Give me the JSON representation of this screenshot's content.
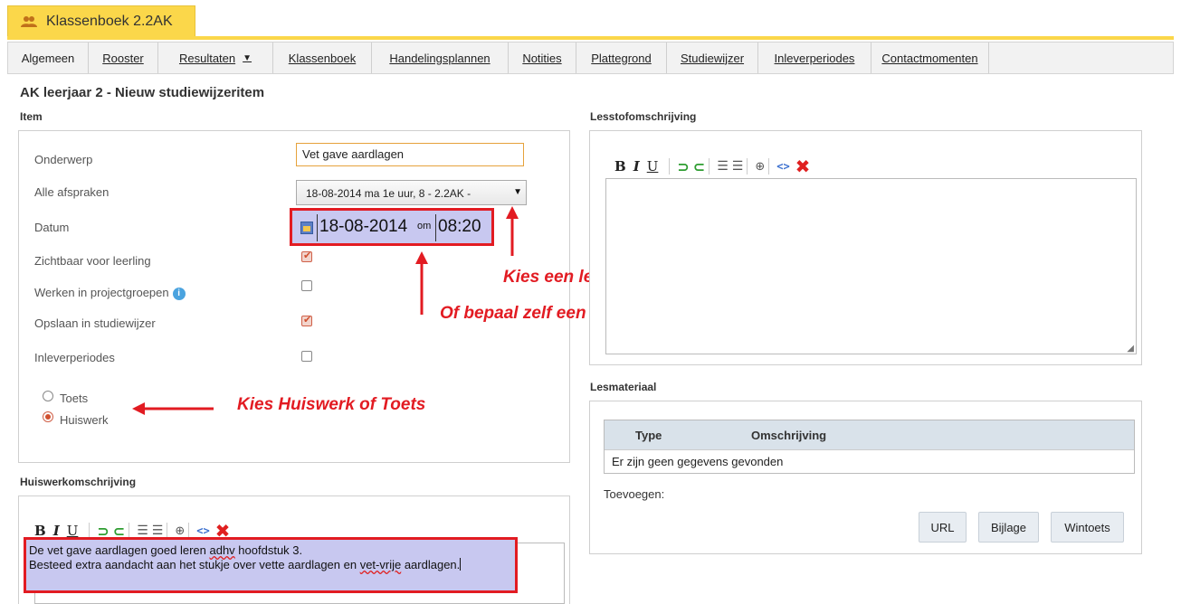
{
  "window": {
    "title": "Klassenboek 2.2AK"
  },
  "menu": [
    {
      "label": "Algemeen",
      "underline": false
    },
    {
      "label": "Rooster"
    },
    {
      "label": "Resultaten"
    },
    {
      "label": "Klassenboek"
    },
    {
      "label": "Handelingsplannen"
    },
    {
      "label": "Notities"
    },
    {
      "label": "Plattegrond"
    },
    {
      "label": "Studiewijzer"
    },
    {
      "label": "Inleverperiodes"
    },
    {
      "label": "Contactmomenten"
    }
  ],
  "page": {
    "title": "AK leerjaar 2 - Nieuw studiewijzeritem"
  },
  "item": {
    "section_label": "Item",
    "onderwerp_label": "Onderwerp",
    "onderwerp_value": "Vet gave aardlagen",
    "afspraken_label": "Alle afspraken",
    "afspraken_value": "18-08-2014 ma 1e uur, 8 - 2.2AK -",
    "datum_label": "Datum",
    "datum_value": "18-08-2014",
    "om_label": "om",
    "tijd_value": "08:20",
    "zichtbaar_label": "Zichtbaar voor leerling",
    "zichtbaar_checked": true,
    "projectgroepen_label": "Werken in projectgroepen",
    "projectgroepen_checked": false,
    "opslaan_label": "Opslaan in studiewijzer",
    "opslaan_checked": true,
    "inleverperiodes_label": "Inleverperiodes",
    "inleverperiodes_checked": false,
    "type_options": [
      "Toets",
      "Huiswerk"
    ],
    "type_selected": "Huiswerk"
  },
  "huiswerk": {
    "section_label": "Huiswerkomschrijving",
    "line1_a": "De vet gave aardlagen goed leren ",
    "line1_err": "adhv",
    "line1_b": " hoofdstuk 3.",
    "line2_a": "Besteed extra aandacht aan het stukje over vette aardlagen en ",
    "line2_err": "vet-vrije",
    "line2_b": " aardlagen."
  },
  "lesstof": {
    "section_label": "Lesstofomschrijving"
  },
  "lesmateriaal": {
    "section_label": "Lesmateriaal",
    "columns": [
      "Type",
      "Omschrijving"
    ],
    "empty_text": "Er zijn geen gegevens gevonden",
    "add_label": "Toevoegen:",
    "buttons": [
      "URL",
      "Bijlage",
      "Wintoets"
    ]
  },
  "toolbar": {
    "bold": "B",
    "italic": "I",
    "underline": "U"
  },
  "annotations": {
    "rooster": "Kies een les uit het rooster",
    "moment": "Of bepaal zelf een moment",
    "huiswerk_toets": "Kies Huiswerk of Toets"
  },
  "colors": {
    "accent": "#fbd74a",
    "highlight": "#e21b22",
    "selection": "#c8c8f0"
  }
}
